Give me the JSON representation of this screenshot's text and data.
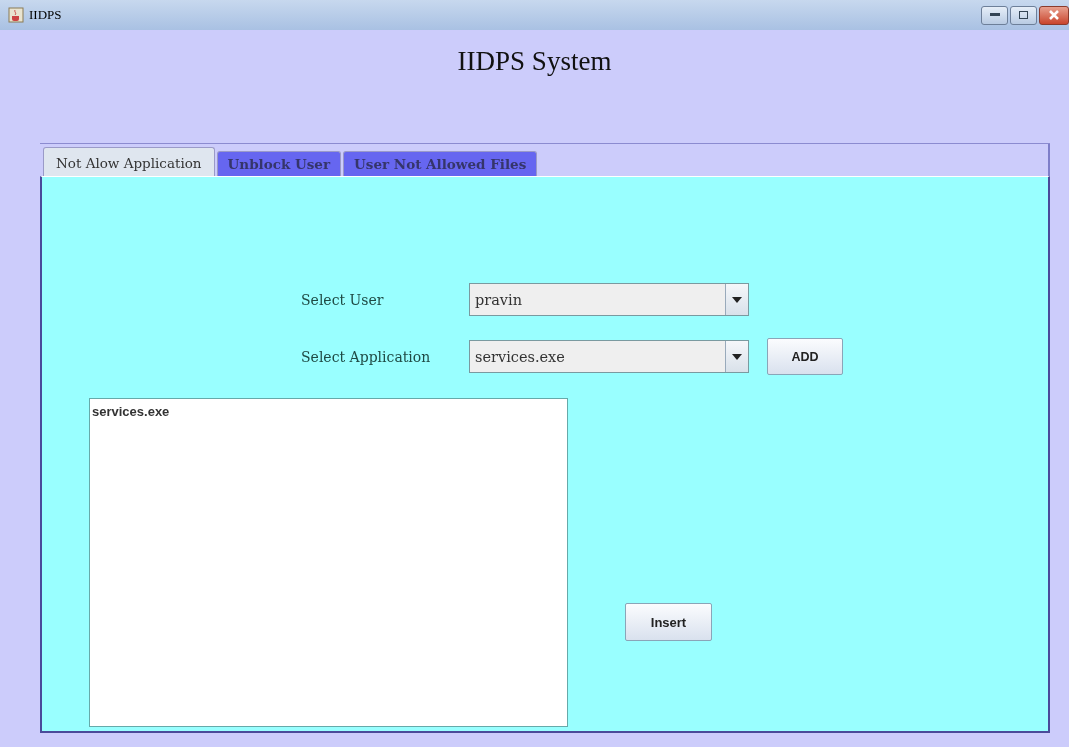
{
  "window": {
    "title": "IIDPS"
  },
  "heading": "IIDPS System",
  "tabs": [
    {
      "label": "Not Alow Application",
      "selected": true
    },
    {
      "label": "Unblock User",
      "selected": false
    },
    {
      "label": "User Not Allowed Files",
      "selected": false
    }
  ],
  "form": {
    "fields": [
      {
        "label": "Select User",
        "value": "pravin"
      },
      {
        "label": "Select Application",
        "value": "services.exe",
        "button": "ADD"
      }
    ],
    "list": {
      "items": [
        "services.exe"
      ]
    },
    "insert_button": "Insert"
  }
}
